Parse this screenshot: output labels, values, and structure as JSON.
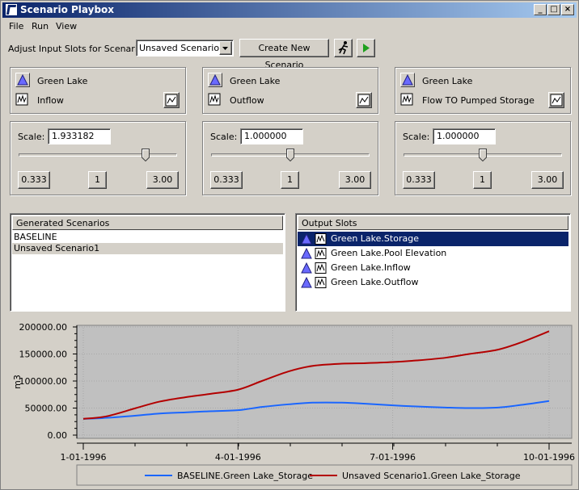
{
  "window": {
    "title": "Scenario Playbox"
  },
  "menu": [
    "File",
    "Run",
    "View"
  ],
  "toolbar": {
    "adjust_label": "Adjust Input Slots for Scenario:",
    "scenario_selected": "Unsaved Scenario1",
    "create_button": "Create New Scenario"
  },
  "input_slots": [
    {
      "object": "Green Lake",
      "slot": "Inflow",
      "scale": "1.933182",
      "fraction": 0.8,
      "min": "0.333",
      "mid": "1",
      "max": "3.00"
    },
    {
      "object": "Green Lake",
      "slot": "Outflow",
      "scale": "1.000000",
      "fraction": 0.5,
      "min": "0.333",
      "mid": "1",
      "max": "3.00"
    },
    {
      "object": "Green Lake",
      "slot": "Flow TO Pumped Storage",
      "scale": "1.000000",
      "fraction": 0.5,
      "min": "0.333",
      "mid": "1",
      "max": "3.00"
    }
  ],
  "scale_label": "Scale:",
  "generated": {
    "header": "Generated Scenarios",
    "items": [
      "BASELINE",
      "Unsaved Scenario1"
    ],
    "selected_index": 1
  },
  "output": {
    "header": "Output Slots",
    "items": [
      "Green Lake.Storage",
      "Green Lake.Pool Elevation",
      "Green Lake.Inflow",
      "Green Lake.Outflow"
    ],
    "selected_index": 0
  },
  "chart_data": {
    "type": "line",
    "ylabel": "m3",
    "ylim": [
      0,
      200000
    ],
    "yticks": [
      "0.00",
      "50000.00",
      "100000.00",
      "150000.00",
      "200000.00"
    ],
    "xticks": [
      "1-01-1996",
      "4-01-1996",
      "7-01-1996",
      "10-01-1996"
    ],
    "x": [
      "1996-01-01",
      "1996-01-15",
      "1996-02-01",
      "1996-02-15",
      "1996-03-01",
      "1996-03-15",
      "1996-04-01",
      "1996-04-15",
      "1996-05-01",
      "1996-05-15",
      "1996-06-01",
      "1996-06-15",
      "1996-07-01",
      "1996-07-15",
      "1996-08-01",
      "1996-08-15",
      "1996-09-01",
      "1996-09-15",
      "1996-10-01"
    ],
    "series": [
      {
        "name": "BASELINE.Green Lake_Storage",
        "color": "#1a66ff",
        "values": [
          30000,
          32000,
          36000,
          40000,
          42000,
          44000,
          46000,
          52000,
          57000,
          60000,
          60000,
          58000,
          55000,
          53000,
          51000,
          50000,
          51000,
          56000,
          63000
        ]
      },
      {
        "name": "Unsaved Scenario1.Green Lake_Storage",
        "color": "#b30000",
        "values": [
          30000,
          35000,
          50000,
          62000,
          70000,
          76000,
          84000,
          100000,
          118000,
          128000,
          132000,
          133000,
          135000,
          138000,
          143000,
          150000,
          158000,
          172000,
          192000
        ]
      }
    ]
  },
  "colors": {
    "selection": "#0a246a",
    "plot_bg": "#c0c0c0",
    "face": "#d4d0c8"
  }
}
